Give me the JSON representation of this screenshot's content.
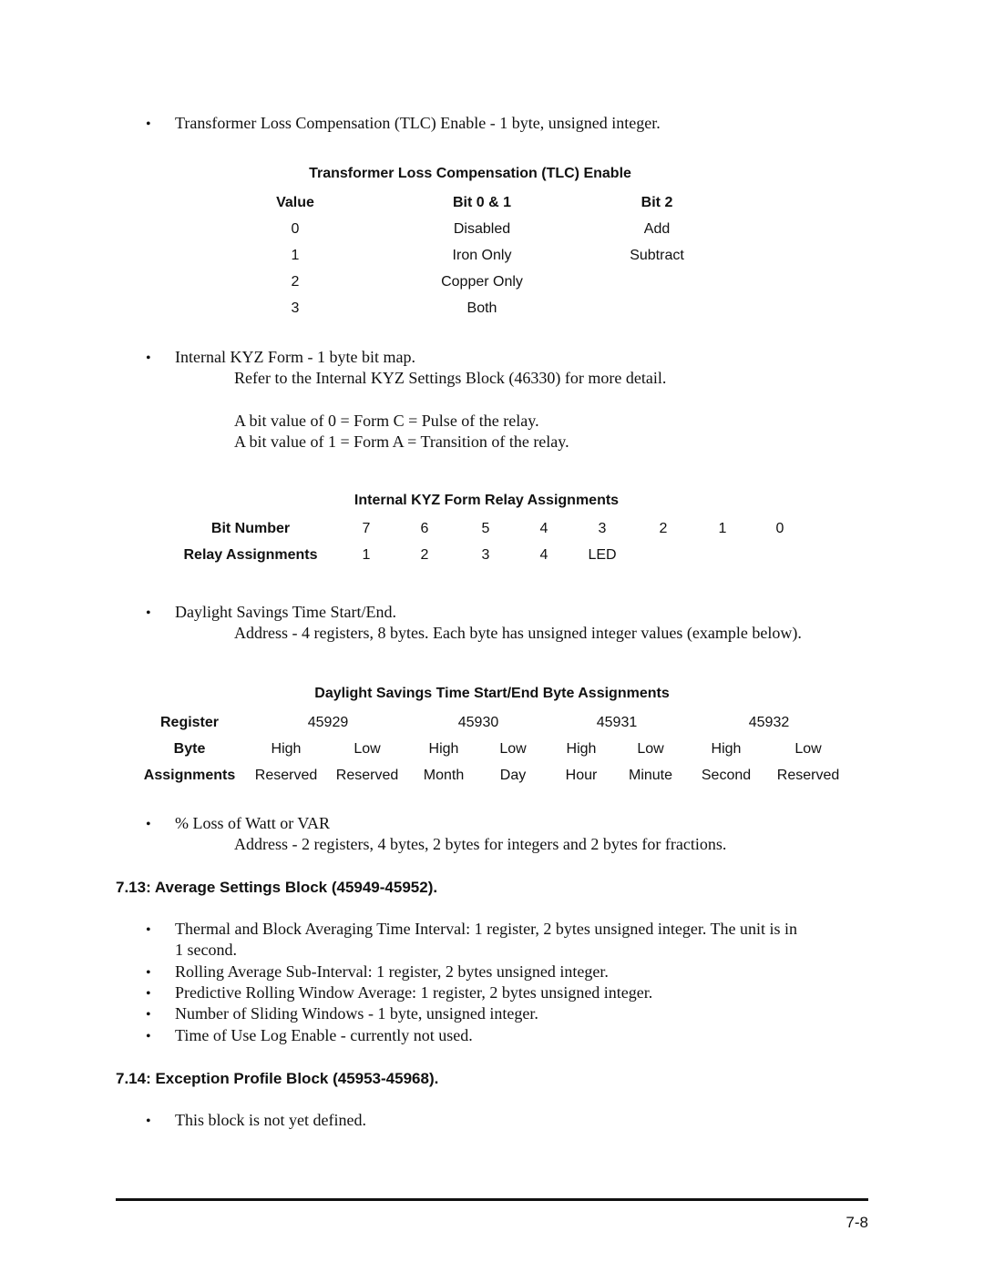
{
  "tlc": {
    "bullet": "Transformer Loss Compensation (TLC) Enable - 1 byte, unsigned integer.",
    "table": {
      "title": "Transformer Loss Compensation (TLC) Enable",
      "headers": [
        "Value",
        "Bit 0 & 1",
        "Bit 2"
      ],
      "rows": [
        [
          "0",
          "Disabled",
          "Add"
        ],
        [
          "1",
          "Iron Only",
          "Subtract"
        ],
        [
          "2",
          "Copper Only",
          ""
        ],
        [
          "3",
          "Both",
          ""
        ]
      ]
    }
  },
  "kyz": {
    "bullet": "Internal KYZ Form - 1 byte bit map.",
    "lines": [
      "Refer to the Internal KYZ Settings Block (46330) for more detail.",
      "A bit value of 0 = Form C = Pulse of the relay.",
      "A bit value of 1 = Form A = Transition of the relay."
    ],
    "table": {
      "title": "Internal KYZ Form Relay Assignments",
      "row1_label": "Bit Number",
      "row1": [
        "7",
        "6",
        "5",
        "4",
        "3",
        "2",
        "1",
        "0"
      ],
      "row2_label": "Relay Assignments",
      "row2": [
        "1",
        "2",
        "3",
        "4",
        "LED",
        "",
        "",
        ""
      ]
    }
  },
  "dst": {
    "bullet": "Daylight Savings Time Start/End.",
    "line": "Address - 4 registers, 8 bytes.  Each byte has unsigned integer values (example below).",
    "table": {
      "title": "Daylight Savings Time Start/End Byte Assignments",
      "register_label": "Register",
      "registers": [
        "45929",
        "45930",
        "45931",
        "45932"
      ],
      "byte_label": "Byte",
      "bytes": [
        "High",
        "Low",
        "High",
        "Low",
        "High",
        "Low",
        "High",
        "Low"
      ],
      "assign_label": "Assignments",
      "assignments": [
        "Reserved",
        "Reserved",
        "Month",
        "Day",
        "Hour",
        "Minute",
        "Second",
        "Reserved"
      ]
    }
  },
  "loss": {
    "bullet": "% Loss of Watt or VAR",
    "line": "Address - 2 registers, 4 bytes, 2 bytes for integers and 2 bytes for fractions."
  },
  "sec713": {
    "heading": "7.13:  Average Settings Block (45949-45952).",
    "bullets": [
      "Thermal and Block Averaging Time Interval: 1 register, 2 bytes unsigned integer.  The unit is in",
      "Rolling Average Sub-Interval: 1 register, 2 bytes unsigned integer.",
      "Predictive Rolling Window Average:  1 register, 2 bytes unsigned integer.",
      "Number of Sliding Windows - 1 byte, unsigned integer.",
      "Time of Use Log Enable - currently not used."
    ],
    "continuation": "1 second."
  },
  "sec714": {
    "heading": "7.14:  Exception Profile Block (45953-45968).",
    "bullets": [
      "This block is not yet defined."
    ]
  },
  "footer": {
    "page_number": "7-8"
  },
  "bullet_char": "•"
}
